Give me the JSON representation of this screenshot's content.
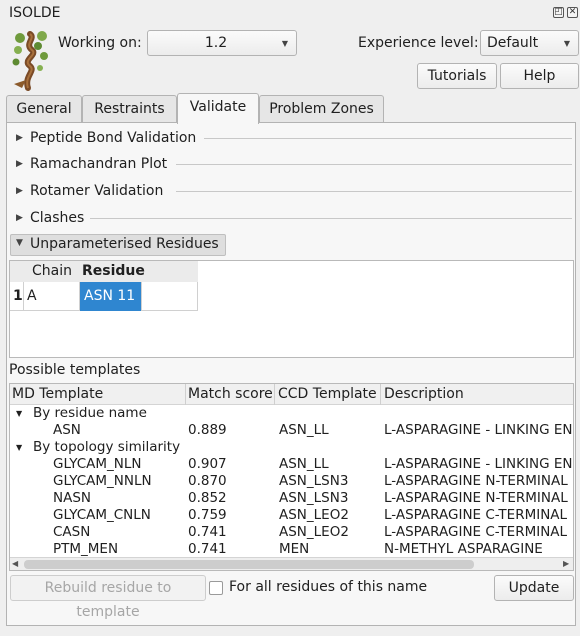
{
  "window": {
    "title": "ISOLDE"
  },
  "header": {
    "working_on_label": "Working on:",
    "working_on_value": "1.2",
    "experience_label": "Experience level:",
    "experience_value": "Default",
    "tutorials_label": "Tutorials",
    "help_label": "Help"
  },
  "tabs": [
    {
      "label": "General"
    },
    {
      "label": "Restraints"
    },
    {
      "label": "Validate"
    },
    {
      "label": "Problem Zones"
    }
  ],
  "sections": [
    {
      "label": "Peptide Bond Validation"
    },
    {
      "label": "Ramachandran Plot"
    },
    {
      "label": "Rotamer Validation"
    },
    {
      "label": "Clashes"
    },
    {
      "label": "Unparameterised Residues"
    }
  ],
  "residue_table": {
    "headers": [
      "Chain",
      "Residue"
    ],
    "rows": [
      {
        "index": "1",
        "chain": "A",
        "residue": "ASN 11"
      }
    ]
  },
  "templates": {
    "label": "Possible templates",
    "headers": [
      "MD Template",
      "Match score",
      "CCD Template",
      "Description"
    ],
    "group_residue_name": "By residue name",
    "group_topology": "By topology similarity",
    "rows": [
      {
        "md": "ASN",
        "score": "0.889",
        "ccd": "ASN_LL",
        "desc": "L-ASPARAGINE - LINKING EN"
      },
      {
        "md": "GLYCAM_NLN",
        "score": "0.907",
        "ccd": "ASN_LL",
        "desc": "L-ASPARAGINE - LINKING EN"
      },
      {
        "md": "GLYCAM_NNLN",
        "score": "0.870",
        "ccd": "ASN_LSN3",
        "desc": "L-ASPARAGINE N-TERMINAL"
      },
      {
        "md": "NASN",
        "score": "0.852",
        "ccd": "ASN_LSN3",
        "desc": "L-ASPARAGINE N-TERMINAL"
      },
      {
        "md": "GLYCAM_CNLN",
        "score": "0.759",
        "ccd": "ASN_LEO2",
        "desc": "L-ASPARAGINE C-TERMINAL"
      },
      {
        "md": "CASN",
        "score": "0.741",
        "ccd": "ASN_LEO2",
        "desc": "L-ASPARAGINE C-TERMINAL"
      },
      {
        "md": "PTM_MEN",
        "score": "0.741",
        "ccd": "MEN",
        "desc": "N-METHYL ASPARAGINE"
      }
    ]
  },
  "footer": {
    "rebuild_label": "Rebuild residue to template",
    "for_all_label": "For all residues of this name",
    "update_label": "Update"
  },
  "colors": {
    "selection": "#2f86d0",
    "window_bg": "#efefef",
    "panel_bg": "#f7f7f7"
  },
  "icons": [
    "isolde-logo-icon",
    "float-window-icon",
    "close-window-icon",
    "chevron-down-icon",
    "triangle-right-icon",
    "triangle-down-icon",
    "arrow-left-icon",
    "arrow-right-icon"
  ]
}
